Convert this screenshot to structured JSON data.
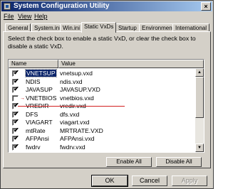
{
  "window": {
    "title": "System Configuration Utility",
    "close_glyph": "×"
  },
  "menu": [
    {
      "label": "File"
    },
    {
      "label": "View"
    },
    {
      "label": "Help"
    }
  ],
  "tabs": [
    "General",
    "System.ini",
    "Win.ini",
    "Static VxDs",
    "Startup",
    "Environment",
    "International"
  ],
  "active_tab": "Static VxDs",
  "description": "Select the check box to enable a static VxD, or clear the check box to disable a static VxD.",
  "list": {
    "columns": [
      "Name",
      "Value"
    ],
    "rows": [
      {
        "name": "VNETSUP",
        "value": "vnetsup.vxd",
        "checked": true,
        "selected": true
      },
      {
        "name": "NDIS",
        "value": "ndis.vxd",
        "checked": true
      },
      {
        "name": "JAVASUP",
        "value": "JAVASUP.VXD",
        "checked": true
      },
      {
        "name": "VNETBIOS",
        "value": "vnetbios.vxd",
        "checked": false
      },
      {
        "name": "VREDIR",
        "value": "vredir.vxd",
        "checked": true
      },
      {
        "name": "DFS",
        "value": "dfs.vxd",
        "checked": true
      },
      {
        "name": "VIAGART",
        "value": "viagart.vxd",
        "checked": true
      },
      {
        "name": "mtRate",
        "value": "MRTRATE.VXD",
        "checked": true
      },
      {
        "name": "AFPAnsi",
        "value": "AFPAnsi.vxd",
        "checked": true
      },
      {
        "name": "fwdrv",
        "value": "fwdrv.vxd",
        "checked": true
      }
    ]
  },
  "annotation_marker": "→",
  "checkmark_glyph": "✔",
  "scroll": {
    "up_glyph": "▲",
    "down_glyph": "▼"
  },
  "buttons": {
    "enable_all": "Enable All",
    "disable_all": "Disable All",
    "ok": "OK",
    "cancel": "Cancel",
    "apply": "Apply"
  },
  "colors": {
    "title_start": "#0a246a",
    "title_end": "#a6caf0",
    "annotation": "#d21f1f"
  }
}
